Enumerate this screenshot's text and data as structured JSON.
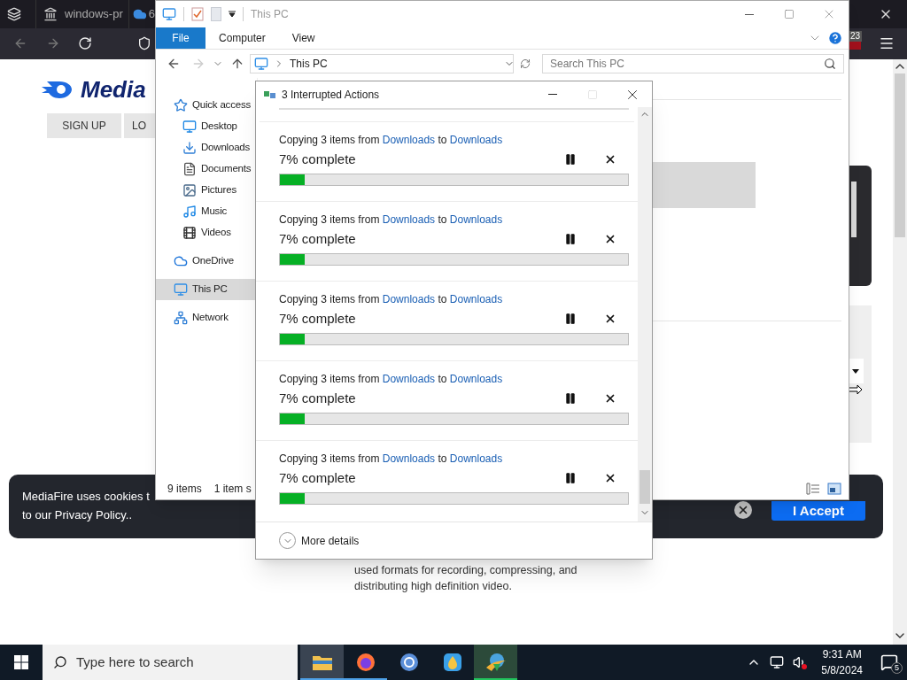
{
  "browser": {
    "tabs": [
      {
        "label": "windows-pr",
        "selected": false
      },
      {
        "label": "6",
        "selected": false
      }
    ],
    "extension_badge": "23"
  },
  "page": {
    "logo": "Media",
    "buttons": [
      "SIGN UP",
      "LO"
    ],
    "cookie_banner": {
      "lines": [
        "MediaFire uses cookies t",
        "to our Privacy Policy.."
      ],
      "accept": "I Accept"
    },
    "paragraph": [
      "used formats for recording, compressing, and",
      "distributing high definition video."
    ]
  },
  "explorer": {
    "title": "This PC",
    "ribbon": [
      {
        "label": "File",
        "kind": "menu"
      },
      {
        "label": "Computer",
        "kind": "tab"
      },
      {
        "label": "View",
        "kind": "tab"
      }
    ],
    "address": "This PC",
    "search": {
      "placeholder": "Search This PC"
    },
    "nav": [
      {
        "label": "Quick access",
        "selected": false,
        "children": [
          {
            "label": "Desktop",
            "selected": false
          },
          {
            "label": "Downloads",
            "selected": false
          },
          {
            "label": "Documents",
            "selected": false
          },
          {
            "label": "Pictures",
            "selected": false
          },
          {
            "label": "Music",
            "selected": false
          },
          {
            "label": "Videos",
            "selected": false
          }
        ]
      },
      {
        "label": "OneDrive",
        "selected": false
      },
      {
        "label": "This PC",
        "selected": true
      },
      {
        "label": "Network",
        "selected": false
      }
    ],
    "status": [
      "9 items",
      "1 item s"
    ]
  },
  "dialog": {
    "title": "3 Interrupted Actions",
    "operations": [
      {
        "prefix": "Copying 3 items from",
        "source": "Downloads",
        "joiner": "to",
        "destination": "Downloads",
        "status": "7% complete",
        "level": 0.07
      },
      {
        "prefix": "Copying 3 items from",
        "source": "Downloads",
        "joiner": "to",
        "destination": "Downloads",
        "status": "7% complete",
        "level": 0.07
      },
      {
        "prefix": "Copying 3 items from",
        "source": "Downloads",
        "joiner": "to",
        "destination": "Downloads",
        "status": "7% complete",
        "level": 0.07
      },
      {
        "prefix": "Copying 3 items from",
        "source": "Downloads",
        "joiner": "to",
        "destination": "Downloads",
        "status": "7% complete",
        "level": 0.07
      },
      {
        "prefix": "Copying 3 items from",
        "source": "Downloads",
        "joiner": "to",
        "destination": "Downloads",
        "status": "7% complete",
        "level": 0.07
      }
    ],
    "more_details": "More details"
  },
  "taskbar": {
    "search_placeholder": "Type here to search",
    "apps": [
      {
        "selected": true,
        "running": true,
        "color": "#4ea1e8"
      },
      {
        "selected": false,
        "running": true,
        "color": "#4ea1e8"
      },
      {
        "selected": false,
        "running": false
      },
      {
        "selected": false,
        "running": false
      },
      {
        "selected": true,
        "running": true,
        "color": "#22c55e"
      }
    ],
    "time": "9:31 AM",
    "date": "5/8/2024",
    "notifications": "5"
  }
}
